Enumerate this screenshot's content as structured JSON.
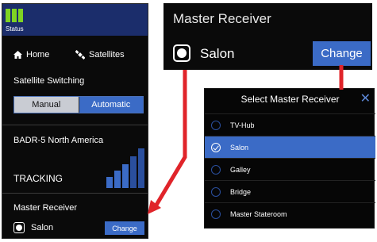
{
  "status": {
    "label": "Status",
    "bar_color": "#7fd323",
    "bg_color": "#1b2d6b"
  },
  "nav": {
    "home_label": "Home",
    "satellites_label": "Satellites"
  },
  "switching": {
    "title": "Satellite Switching",
    "manual_label": "Manual",
    "automatic_label": "Automatic",
    "selected": "Automatic"
  },
  "satellite": {
    "name": "BADR-5 North America",
    "state": "TRACKING"
  },
  "receiver": {
    "title": "Master Receiver",
    "current": "Salon",
    "change_label": "Change"
  },
  "zoom": {
    "title": "Master Receiver",
    "current": "Salon",
    "change_label": "Change"
  },
  "dialog": {
    "title": "Select Master Receiver",
    "close_icon": "close-icon",
    "options": [
      {
        "label": "TV-Hub",
        "selected": false
      },
      {
        "label": "Salon",
        "selected": true
      },
      {
        "label": "Galley",
        "selected": false
      },
      {
        "label": "Bridge",
        "selected": false
      },
      {
        "label": "Master Stateroom",
        "selected": false
      }
    ]
  },
  "colors": {
    "accent": "#3b6bc6",
    "arrow": "#e0242a"
  }
}
